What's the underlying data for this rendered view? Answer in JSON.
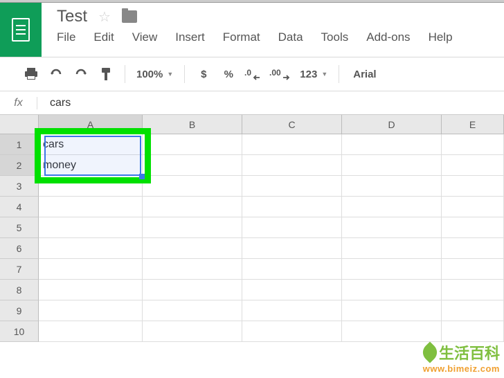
{
  "document": {
    "title": "Test"
  },
  "menu": {
    "file": "File",
    "edit": "Edit",
    "view": "View",
    "insert": "Insert",
    "format": "Format",
    "data": "Data",
    "tools": "Tools",
    "addons": "Add-ons",
    "help": "Help"
  },
  "toolbar": {
    "zoom": "100%",
    "currency": "$",
    "percent": "%",
    "dec_dec": ".0",
    "inc_dec": ".00",
    "more_formats": "123",
    "font": "Arial"
  },
  "formula_bar": {
    "label": "fx",
    "value": "cars"
  },
  "columns": [
    "A",
    "B",
    "C",
    "D",
    "E"
  ],
  "rows": [
    "1",
    "2",
    "3",
    "4",
    "5",
    "6",
    "7",
    "8",
    "9",
    "10"
  ],
  "cells": {
    "A1": "cars",
    "A2": "money"
  },
  "selection": {
    "active_col": "A",
    "active_rows": [
      "1",
      "2"
    ]
  },
  "watermark": {
    "text": "生活百科",
    "url": "www.bimeiz.com"
  }
}
